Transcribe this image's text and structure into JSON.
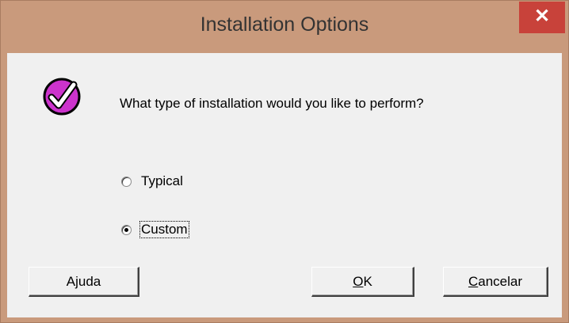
{
  "window": {
    "title": "Installation Options",
    "close_glyph": "✕"
  },
  "dialog": {
    "icon": "checkmark-icon",
    "question": "What type of installation would you like to perform?",
    "options": [
      {
        "label": "Typical",
        "selected": false
      },
      {
        "label": "Custom",
        "selected": true
      }
    ]
  },
  "buttons": {
    "help": {
      "label": "Ajuda"
    },
    "ok": {
      "mnemonic": "O",
      "rest": "K"
    },
    "cancel": {
      "mnemonic": "C",
      "rest": "ancelar"
    }
  },
  "colors": {
    "frame": "#c99a7c",
    "close_button": "#c8423a",
    "icon_fill": "#cc33cc",
    "client_bg": "#f0f0f0"
  }
}
